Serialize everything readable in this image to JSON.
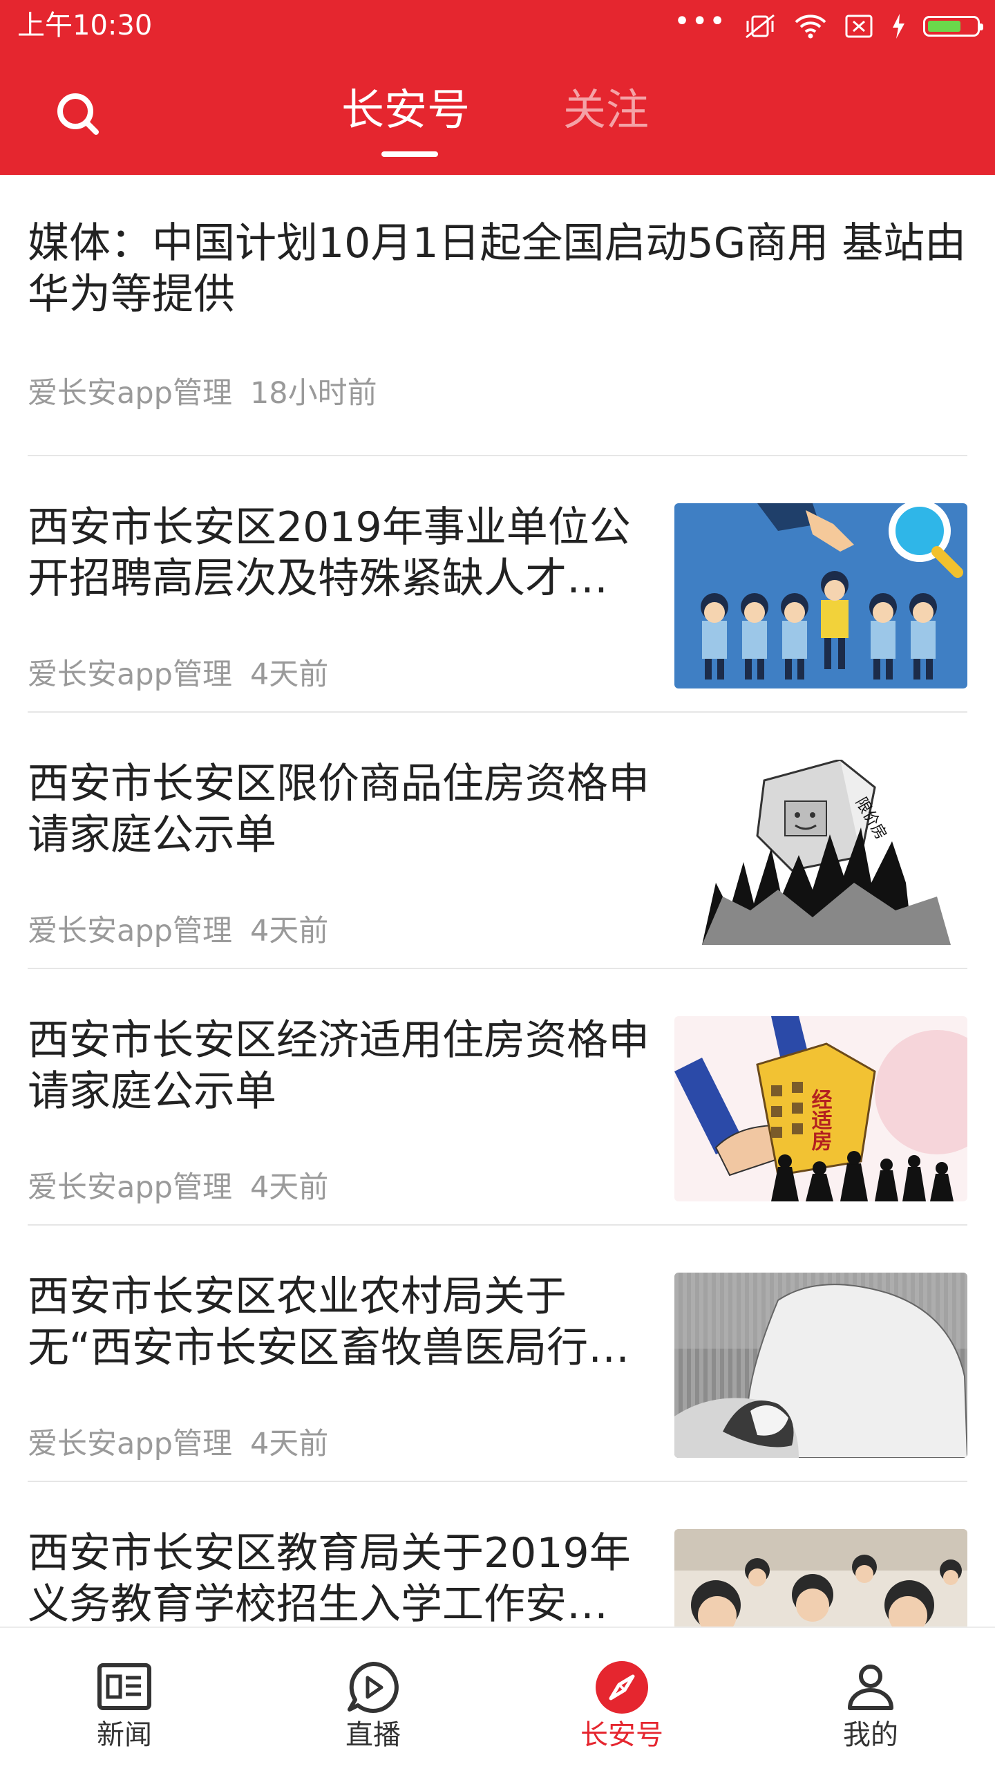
{
  "status_bar": {
    "time": "上午10:30",
    "battery_level": 0.62
  },
  "header": {
    "tabs": [
      {
        "label": "长安号",
        "active": true
      },
      {
        "label": "关注",
        "active": false
      }
    ],
    "search_icon": "search-icon"
  },
  "feed": {
    "items": [
      {
        "title": "媒体：中国计划10月1日起全国启动5G商用 基站由华为等提供",
        "author": "爱长安app管理",
        "time": "18小时前",
        "has_thumbnail": false
      },
      {
        "title": "西安市长安区2019年事业单位公开招聘高层次及特殊紧缺人才…",
        "author": "爱长安app管理",
        "time": "4天前",
        "has_thumbnail": true
      },
      {
        "title": "西安市长安区限价商品住房资格申请家庭公示单",
        "author": "爱长安app管理",
        "time": "4天前",
        "has_thumbnail": true,
        "thumbnail_text": "限价房"
      },
      {
        "title": "西安市长安区经济适用住房资格申请家庭公示单",
        "author": "爱长安app管理",
        "time": "4天前",
        "has_thumbnail": true,
        "thumbnail_text": "经适房"
      },
      {
        "title": "西安市长安区农业农村局关于无“西安市长安区畜牧兽医局行…",
        "author": "爱长安app管理",
        "time": "4天前",
        "has_thumbnail": true
      },
      {
        "title": "西安市长安区教育局关于2019年义务教育学校招生入学工作安…",
        "author": "",
        "time": "",
        "has_thumbnail": true
      }
    ]
  },
  "bottom_nav": {
    "items": [
      {
        "label": "新闻",
        "icon": "newspaper-icon",
        "active": false
      },
      {
        "label": "直播",
        "icon": "play-icon",
        "active": false
      },
      {
        "label": "长安号",
        "icon": "compass-icon",
        "active": true
      },
      {
        "label": "我的",
        "icon": "user-icon",
        "active": false
      }
    ]
  },
  "colors": {
    "brand": "#e5262f",
    "text": "#222222",
    "meta": "#9a9a9a",
    "inactive_tab": "#f4a3a7"
  }
}
